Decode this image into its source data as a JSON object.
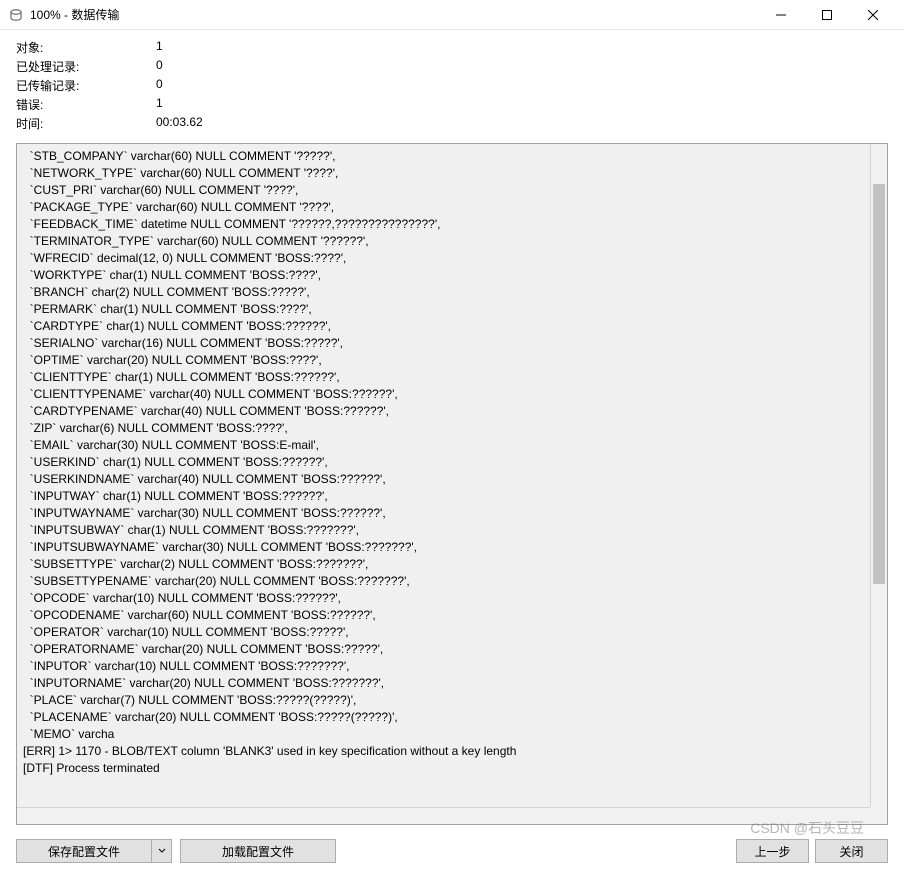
{
  "titlebar": {
    "title": "100% - 数据传输"
  },
  "stats": {
    "labels": {
      "objects": "对象:",
      "processed": "已处理记录:",
      "transferred": "已传输记录:",
      "errors": "错误:",
      "time": "时间:"
    },
    "values": {
      "objects": "1",
      "processed": "0",
      "transferred": "0",
      "errors": "1",
      "time": "00:03.62"
    }
  },
  "log": {
    "lines": [
      "  `STB_COMPANY` varchar(60) NULL COMMENT '?????',",
      "  `NETWORK_TYPE` varchar(60) NULL COMMENT '????',",
      "  `CUST_PRI` varchar(60) NULL COMMENT '????',",
      "  `PACKAGE_TYPE` varchar(60) NULL COMMENT '????',",
      "  `FEEDBACK_TIME` datetime NULL COMMENT '??????,???????????????',",
      "  `TERMINATOR_TYPE` varchar(60) NULL COMMENT '??????',",
      "  `WFRECID` decimal(12, 0) NULL COMMENT 'BOSS:????',",
      "  `WORKTYPE` char(1) NULL COMMENT 'BOSS:????',",
      "  `BRANCH` char(2) NULL COMMENT 'BOSS:?????',",
      "  `PERMARK` char(1) NULL COMMENT 'BOSS:????',",
      "  `CARDTYPE` char(1) NULL COMMENT 'BOSS:??????',",
      "  `SERIALNO` varchar(16) NULL COMMENT 'BOSS:?????',",
      "  `OPTIME` varchar(20) NULL COMMENT 'BOSS:????',",
      "  `CLIENTTYPE` char(1) NULL COMMENT 'BOSS:??????',",
      "  `CLIENTTYPENAME` varchar(40) NULL COMMENT 'BOSS:??????',",
      "  `CARDTYPENAME` varchar(40) NULL COMMENT 'BOSS:??????',",
      "  `ZIP` varchar(6) NULL COMMENT 'BOSS:????',",
      "  `EMAIL` varchar(30) NULL COMMENT 'BOSS:E-mail',",
      "  `USERKIND` char(1) NULL COMMENT 'BOSS:??????',",
      "  `USERKINDNAME` varchar(40) NULL COMMENT 'BOSS:??????',",
      "  `INPUTWAY` char(1) NULL COMMENT 'BOSS:??????',",
      "  `INPUTWAYNAME` varchar(30) NULL COMMENT 'BOSS:??????',",
      "  `INPUTSUBWAY` char(1) NULL COMMENT 'BOSS:???????',",
      "  `INPUTSUBWAYNAME` varchar(30) NULL COMMENT 'BOSS:???????',",
      "  `SUBSETTYPE` varchar(2) NULL COMMENT 'BOSS:???????',",
      "  `SUBSETTYPENAME` varchar(20) NULL COMMENT 'BOSS:???????',",
      "  `OPCODE` varchar(10) NULL COMMENT 'BOSS:??????',",
      "  `OPCODENAME` varchar(60) NULL COMMENT 'BOSS:??????',",
      "  `OPERATOR` varchar(10) NULL COMMENT 'BOSS:?????',",
      "  `OPERATORNAME` varchar(20) NULL COMMENT 'BOSS:?????',",
      "  `INPUTOR` varchar(10) NULL COMMENT 'BOSS:???????',",
      "  `INPUTORNAME` varchar(20) NULL COMMENT 'BOSS:???????',",
      "  `PLACE` varchar(7) NULL COMMENT 'BOSS:?????(?????)',",
      "  `PLACENAME` varchar(20) NULL COMMENT 'BOSS:?????(?????)',",
      "  `MEMO` varcha",
      "[ERR] 1> 1170 - BLOB/TEXT column 'BLANK3' used in key specification without a key length",
      "[DTF] Process terminated"
    ]
  },
  "footer": {
    "save_label": "保存配置文件",
    "load_label": "加载配置文件",
    "prev_label": "上一步",
    "close_label": "关闭"
  },
  "watermark": "CSDN @石头豆豆"
}
